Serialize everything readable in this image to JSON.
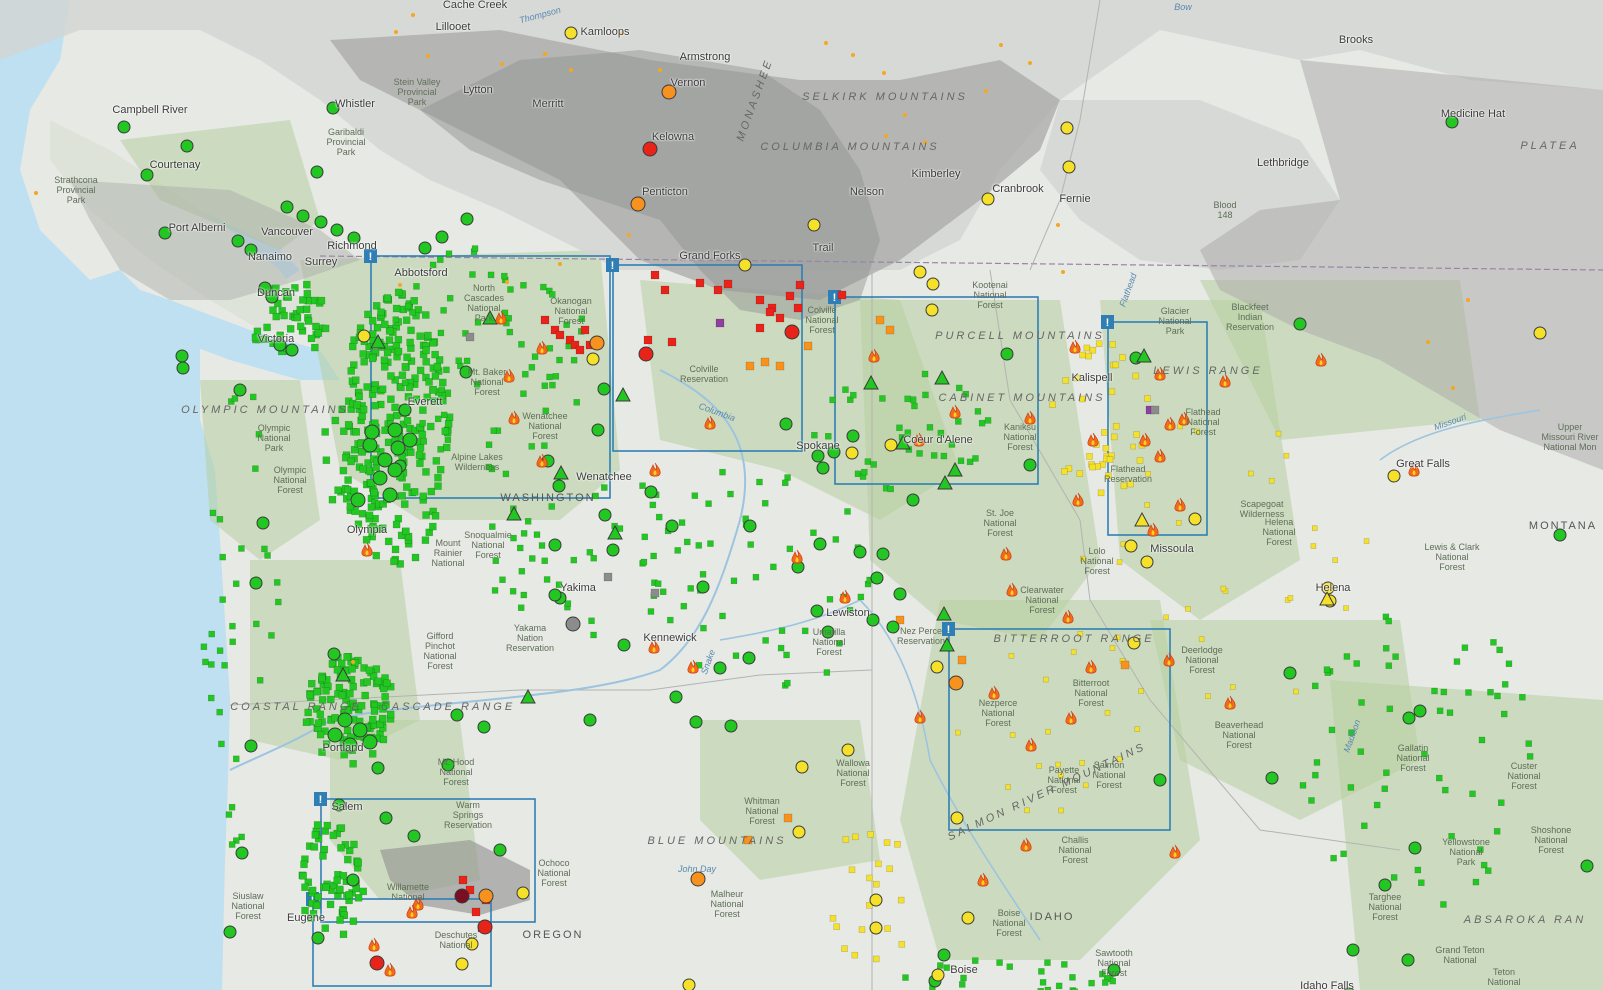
{
  "colors": {
    "water": "#bfe0f0",
    "land": "#e7e9e4",
    "forest": "#b6cfa0",
    "smoke_light": "#d3d4d2",
    "smoke_medium": "#a9aaa8",
    "smoke_heavy": "#8f908e",
    "aq_good": "#22c722",
    "aq_moderate": "#f5e12a",
    "aq_usg": "#f7921e",
    "aq_unhealthy": "#e8231a",
    "aq_very_unhealthy": "#8e3fa0",
    "aq_hazardous": "#7a0e23",
    "box_outline": "#2f7fb5",
    "fire_icon": "#f26b1d"
  },
  "labels": {
    "cities": [
      {
        "text": "Cache Creek"
      },
      {
        "text": "Lillooet"
      },
      {
        "text": "Kamloops"
      },
      {
        "text": "Armstrong"
      },
      {
        "text": "Vernon"
      },
      {
        "text": "Lytton"
      },
      {
        "text": "Merritt"
      },
      {
        "text": "Whistler"
      },
      {
        "text": "Campbell River"
      },
      {
        "text": "Courtenay"
      },
      {
        "text": "Kelowna"
      },
      {
        "text": "Penticton"
      },
      {
        "text": "Port Alberni"
      },
      {
        "text": "Vancouver"
      },
      {
        "text": "Nanaimo"
      },
      {
        "text": "Richmond"
      },
      {
        "text": "Surrey"
      },
      {
        "text": "Abbotsford"
      },
      {
        "text": "Duncan"
      },
      {
        "text": "Victoria"
      },
      {
        "text": "Grand Forks"
      },
      {
        "text": "Trail"
      },
      {
        "text": "Nelson"
      },
      {
        "text": "Kimberley"
      },
      {
        "text": "Cranbrook"
      },
      {
        "text": "Fernie"
      },
      {
        "text": "Brooks"
      },
      {
        "text": "Medicine Hat"
      },
      {
        "text": "Lethbridge"
      },
      {
        "text": "Kalispell"
      },
      {
        "text": "Spokane"
      },
      {
        "text": "Wenatchee"
      },
      {
        "text": "Everett"
      },
      {
        "text": "Olympia"
      },
      {
        "text": "Yakima"
      },
      {
        "text": "Kennewick"
      },
      {
        "text": "Lewiston"
      },
      {
        "text": "Missoula"
      },
      {
        "text": "Great Falls"
      },
      {
        "text": "Helena"
      },
      {
        "text": "Portland"
      },
      {
        "text": "Salem"
      },
      {
        "text": "Eugene"
      },
      {
        "text": "Boise"
      },
      {
        "text": "Idaho Falls"
      },
      {
        "text": "Coeur d'Alene"
      }
    ],
    "forests": [
      {
        "text": "Strathcona\nProvincial\nPark"
      },
      {
        "text": "Stein Valley\nProvincial\nPark"
      },
      {
        "text": "Garibaldi\nProvincial\nPark"
      },
      {
        "text": "North\nCascades\nNational\nPark"
      },
      {
        "text": "Okanogan\nNational\nForest"
      },
      {
        "text": "Colville\nReservation"
      },
      {
        "text": "Colville\nNational\nForest"
      },
      {
        "text": "Kootenai\nNational\nForest"
      },
      {
        "text": "Glacier\nNational\nPark"
      },
      {
        "text": "Blackfeet\nIndian\nReservation"
      },
      {
        "text": "Blood\n148"
      },
      {
        "text": "Mt. Baker\nNational\nForest"
      },
      {
        "text": "Wenatchee\nNational\nForest"
      },
      {
        "text": "Alpine Lakes\nWilderness"
      },
      {
        "text": "Olympic\nNational\nPark"
      },
      {
        "text": "Olympic\nNational\nForest"
      },
      {
        "text": "Snoqualmie\nNational\nForest"
      },
      {
        "text": "Mount\nRainier\nNational"
      },
      {
        "text": "Kaniksu\nNational\nForest"
      },
      {
        "text": "Flathead\nNational\nForest"
      },
      {
        "text": "Flathead\nReservation"
      },
      {
        "text": "Scapegoat\nWilderness"
      },
      {
        "text": "Helena\nNational\nForest"
      },
      {
        "text": "St. Joe\nNational\nForest"
      },
      {
        "text": "Lolo\nNational\nForest"
      },
      {
        "text": "Clearwater\nNational\nForest"
      },
      {
        "text": "Lewis & Clark\nNational\nForest"
      },
      {
        "text": "Gifford\nPinchot\nNational\nForest"
      },
      {
        "text": "Yakama\nNation\nReservation"
      },
      {
        "text": "Umatilla\nNational\nForest"
      },
      {
        "text": "Nez Perce\nReservation"
      },
      {
        "text": "Deerlodge\nNational\nForest"
      },
      {
        "text": "Beaverhead\nNational\nForest"
      },
      {
        "text": "Nezperce\nNational\nForest"
      },
      {
        "text": "Bitterroot\nNational\nForest"
      },
      {
        "text": "Mt. Hood\nNational\nForest"
      },
      {
        "text": "Wallowa\nNational\nForest"
      },
      {
        "text": "Whitman\nNational\nForest"
      },
      {
        "text": "Payette\nNational\nForest"
      },
      {
        "text": "Salmon\nNational\nForest"
      },
      {
        "text": "Gallatin\nNational\nForest"
      },
      {
        "text": "Custer\nNational\nForest"
      },
      {
        "text": "Warm\nSprings\nReservation"
      },
      {
        "text": "Ochoco\nNational\nForest"
      },
      {
        "text": "Willamette\nNational"
      },
      {
        "text": "Siuslaw\nNational\nForest"
      },
      {
        "text": "Deschutes\nNational"
      },
      {
        "text": "Malheur\nNational\nForest"
      },
      {
        "text": "Challis\nNational\nForest"
      },
      {
        "text": "Boise\nNational\nForest"
      },
      {
        "text": "Sawtooth\nNational\nForest"
      },
      {
        "text": "Yellowstone\nNational\nPark"
      },
      {
        "text": "Shoshone\nNational\nForest"
      },
      {
        "text": "Targhee\nNational\nForest"
      },
      {
        "text": "Grand Teton\nNational"
      },
      {
        "text": "Teton\nNational"
      },
      {
        "text": "Upper\nMissouri River\nNational Mon"
      }
    ],
    "ranges": [
      {
        "text": "SELKIRK MOUNTAINS"
      },
      {
        "text": "COLUMBIA MOUNTAINS"
      },
      {
        "text": "PURCELL MOUNTAINS"
      },
      {
        "text": "CABINET MOUNTAINS"
      },
      {
        "text": "LEWIS RANGE"
      },
      {
        "text": "OLYMPIC MOUNTAINS"
      },
      {
        "text": "BITTERROOT RANGE"
      },
      {
        "text": "COASTAL RANGE"
      },
      {
        "text": "CASCADE RANGE"
      },
      {
        "text": "BLUE MOUNTAINS"
      },
      {
        "text": "SALMON RIVER MOUNTAINS"
      },
      {
        "text": "ABSAROKA RAN"
      },
      {
        "text": "PLATEA"
      },
      {
        "text": "MONASHEE"
      }
    ],
    "states": [
      {
        "text": "WASHINGTON"
      },
      {
        "text": "MONTANA"
      },
      {
        "text": "OREGON"
      },
      {
        "text": "IDAHO"
      }
    ],
    "water": [
      {
        "text": "Thompson"
      },
      {
        "text": "Bow"
      },
      {
        "text": "Columbia"
      },
      {
        "text": "Snake"
      },
      {
        "text": "John Day"
      },
      {
        "text": "Missouri"
      },
      {
        "text": "Madison"
      },
      {
        "text": "Flathead"
      }
    ]
  },
  "alert_box_badge": "!"
}
